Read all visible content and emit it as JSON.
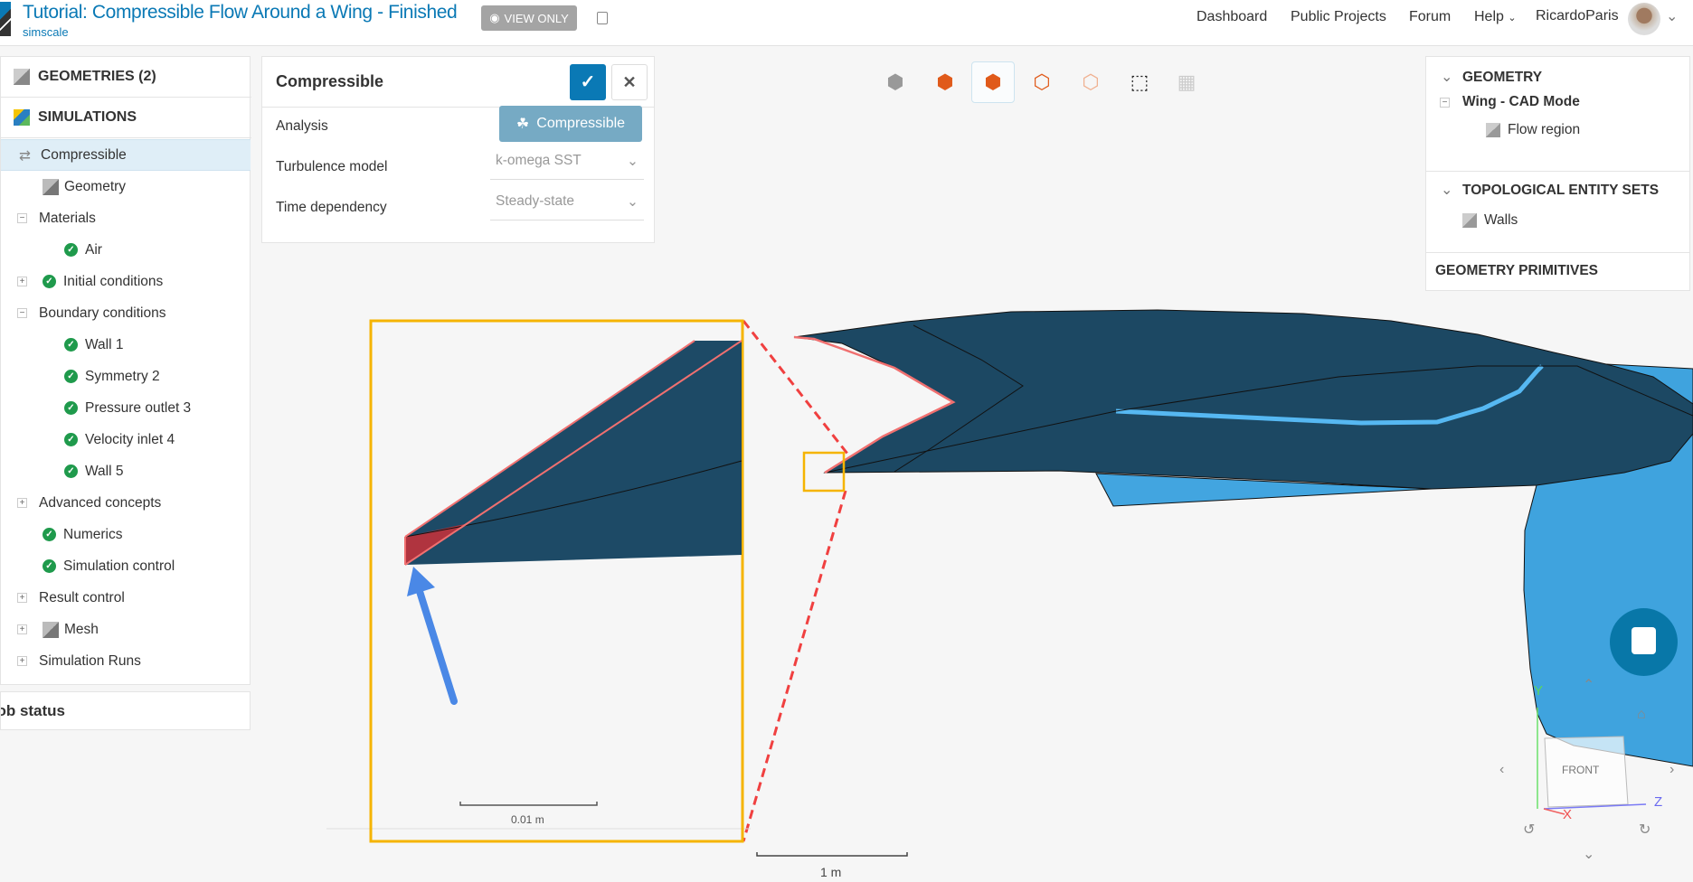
{
  "header": {
    "title": "Tutorial: Compressible Flow Around a Wing - Finished",
    "subtitle": "simscale",
    "view_only": "VIEW ONLY",
    "nav": [
      "Dashboard",
      "Public Projects",
      "Forum",
      "Help"
    ],
    "user": "RicardoParis"
  },
  "left": {
    "geometries": "GEOMETRIES (2)",
    "simulations": "SIMULATIONS",
    "tree": [
      {
        "label": "Compressible",
        "depth": 0,
        "icon": "physics-icon",
        "selected": true
      },
      {
        "label": "Geometry",
        "depth": 1,
        "icon": "geometry-icon"
      },
      {
        "label": "Materials",
        "depth": 0,
        "expander": "-"
      },
      {
        "label": "Air",
        "depth": 2,
        "icon": "check-icon"
      },
      {
        "label": "Initial conditions",
        "depth": 1,
        "icon": "check-icon",
        "expander": "+"
      },
      {
        "label": "Boundary conditions",
        "depth": 0,
        "expander": "-"
      },
      {
        "label": "Wall 1",
        "depth": 2,
        "icon": "check-icon"
      },
      {
        "label": "Symmetry 2",
        "depth": 2,
        "icon": "check-icon"
      },
      {
        "label": "Pressure outlet 3",
        "depth": 2,
        "icon": "check-icon"
      },
      {
        "label": "Velocity inlet 4",
        "depth": 2,
        "icon": "check-icon"
      },
      {
        "label": "Wall 5",
        "depth": 2,
        "icon": "check-icon"
      },
      {
        "label": "Advanced concepts",
        "depth": 0,
        "expander": "+"
      },
      {
        "label": "Numerics",
        "depth": 1,
        "icon": "check-icon"
      },
      {
        "label": "Simulation control",
        "depth": 1,
        "icon": "check-icon"
      },
      {
        "label": "Result control",
        "depth": 0,
        "expander": "+"
      },
      {
        "label": "Mesh",
        "depth": 1,
        "icon": "mesh-icon",
        "expander": "+"
      },
      {
        "label": "Simulation Runs",
        "depth": 0,
        "expander": "+"
      }
    ],
    "job_status": "Job status"
  },
  "panel": {
    "title": "Compressible",
    "analysis_label": "Analysis",
    "analysis_value": "Compressible",
    "turbulence_label": "Turbulence model",
    "turbulence_value": "k-omega SST",
    "time_label": "Time dependency",
    "time_value": "Steady-state"
  },
  "right": {
    "geometry": "GEOMETRY",
    "wing": "Wing - CAD Mode",
    "flow": "Flow region",
    "topo": "TOPOLOGICAL ENTITY SETS",
    "walls": "Walls",
    "primitives": "GEOMETRY PRIMITIVES"
  },
  "toolbar": [
    "solid-view-icon",
    "select-volume-icon",
    "select-face-icon",
    "select-edge-icon",
    "select-point-icon",
    "box-select-icon",
    "mesh-view-icon"
  ],
  "viewport": {
    "inset_scale": "0.01 m",
    "scale": "1 m",
    "cube_face": "FRONT",
    "axes": [
      "X",
      "Y",
      "Z"
    ]
  },
  "colors": {
    "brand": "#0a79b5",
    "wing": "#1c4863",
    "fuselage": "#3fa3de",
    "highlight": "#f07070",
    "callout": "#f5b400",
    "arrow": "#4a88e6"
  }
}
